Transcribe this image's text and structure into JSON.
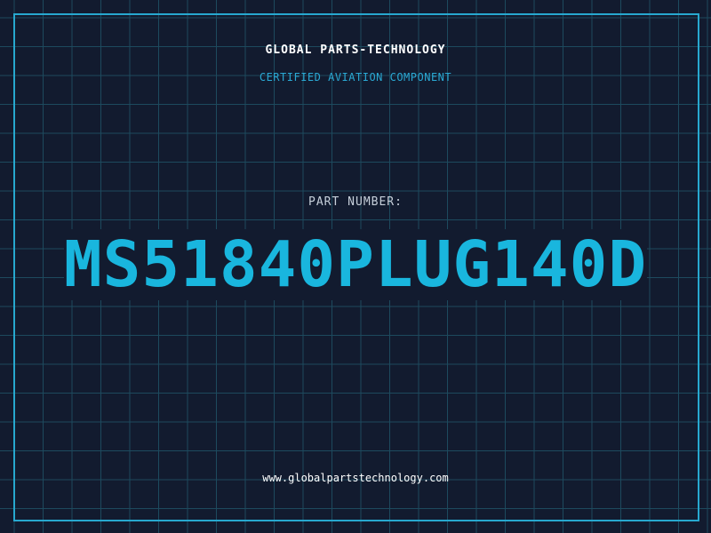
{
  "header": {
    "company": "GLOBAL PARTS-TECHNOLOGY",
    "tagline": "CERTIFIED AVIATION COMPONENT"
  },
  "part": {
    "label": "PART NUMBER:",
    "number": "MS51840PLUG140D"
  },
  "footer": {
    "website": "www.globalpartstechnology.com"
  },
  "colors": {
    "background": "#121b2f",
    "grid": "#1d4a5e",
    "accent": "#19b6de",
    "frame": "#27a8cf",
    "text": "#ffffff"
  }
}
